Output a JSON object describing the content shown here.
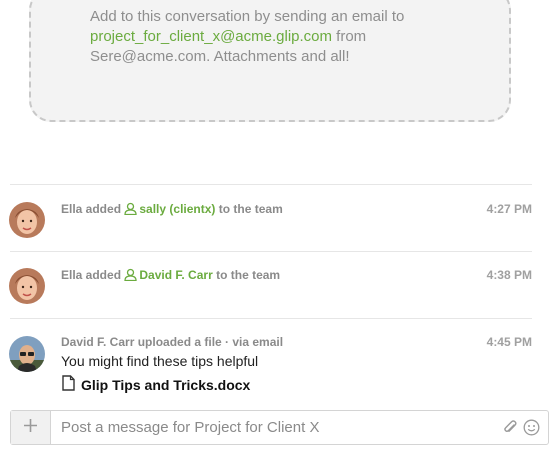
{
  "email_info": {
    "line1": "Add to this conversation by sending an email to",
    "address": "project_for_client_x@acme.glip.com",
    "after_address": " from",
    "line3": "Sere@acme.com. Attachments and all!"
  },
  "events": [
    {
      "actor": "Ella added",
      "mention": "sally (clientx)",
      "suffix": "to the team",
      "time": "4:27 PM"
    },
    {
      "actor": "Ella added",
      "mention": "David F. Carr",
      "suffix": "to the team",
      "time": "4:38 PM"
    }
  ],
  "post": {
    "header": "David F. Carr uploaded a file · via email",
    "time": "4:45 PM",
    "message": "You might find these tips helpful",
    "file_name": "Glip Tips and Tricks.docx"
  },
  "composer": {
    "placeholder": "Post a message for Project for Client X"
  },
  "colors": {
    "accent": "#6bab3f",
    "muted_text": "#8a8a8a"
  }
}
